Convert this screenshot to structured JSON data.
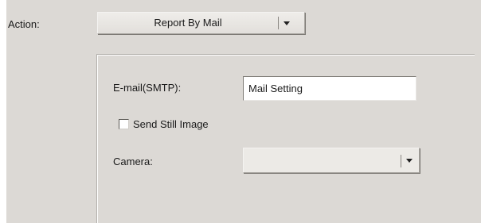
{
  "action": {
    "label": "Action:",
    "selected": "Report By Mail"
  },
  "email": {
    "label": "E-mail(SMTP):",
    "value": "Mail Setting"
  },
  "send_still_image": {
    "label": "Send Still Image",
    "checked": false
  },
  "camera": {
    "label": "Camera:",
    "selected": ""
  },
  "icons": {
    "dropdown_arrow": "chevron-down-icon"
  }
}
